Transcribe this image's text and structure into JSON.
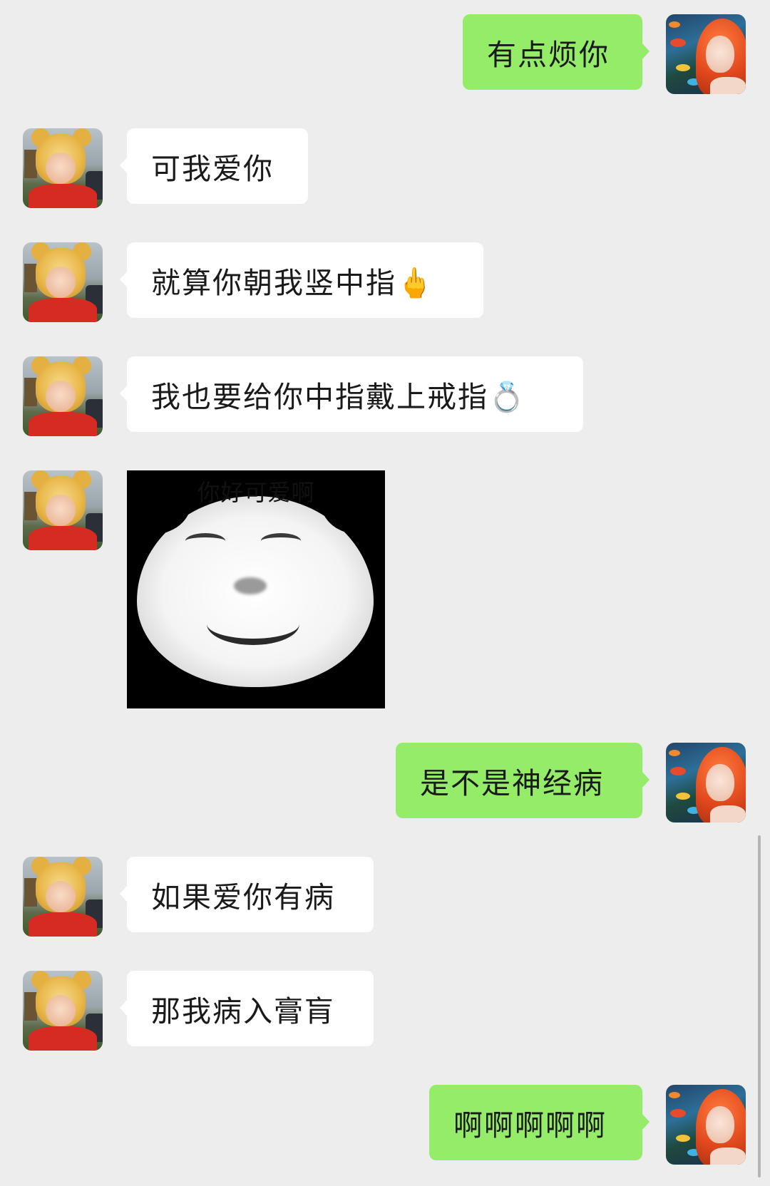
{
  "messages": [
    {
      "side": "sent",
      "type": "text",
      "text": "有点烦你"
    },
    {
      "side": "recv",
      "type": "text",
      "text": "可我爱你"
    },
    {
      "side": "recv",
      "type": "text",
      "text": "就算你朝我竖中指🖕"
    },
    {
      "side": "recv",
      "type": "text",
      "text": "我也要给你中指戴上戒指💍"
    },
    {
      "side": "recv",
      "type": "sticker",
      "caption": "你好可爱啊"
    },
    {
      "side": "sent",
      "type": "text",
      "text": "是不是神经病"
    },
    {
      "side": "recv",
      "type": "text",
      "text": "如果爱你有病"
    },
    {
      "side": "recv",
      "type": "text",
      "text": "那我病入膏肓"
    },
    {
      "side": "sent",
      "type": "text",
      "text": "啊啊啊啊啊"
    }
  ],
  "colors": {
    "background": "#ededed",
    "sent_bubble": "#95ec69",
    "received_bubble": "#ffffff"
  },
  "icons": {
    "self_avatar": "red-haired-girl-avatar",
    "contact_avatar": "pooh-costume-baby-avatar"
  }
}
